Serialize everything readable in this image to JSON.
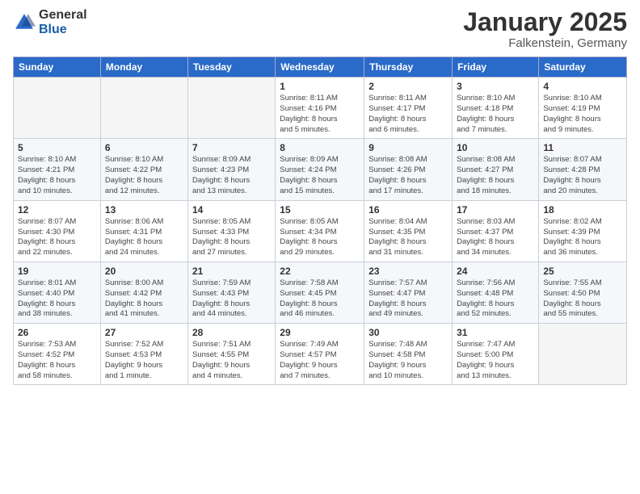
{
  "header": {
    "logo_general": "General",
    "logo_blue": "Blue",
    "title": "January 2025",
    "subtitle": "Falkenstein, Germany"
  },
  "days_of_week": [
    "Sunday",
    "Monday",
    "Tuesday",
    "Wednesday",
    "Thursday",
    "Friday",
    "Saturday"
  ],
  "weeks": [
    [
      {
        "num": "",
        "info": "",
        "empty": true
      },
      {
        "num": "",
        "info": "",
        "empty": true
      },
      {
        "num": "",
        "info": "",
        "empty": true
      },
      {
        "num": "1",
        "info": "Sunrise: 8:11 AM\nSunset: 4:16 PM\nDaylight: 8 hours\nand 5 minutes."
      },
      {
        "num": "2",
        "info": "Sunrise: 8:11 AM\nSunset: 4:17 PM\nDaylight: 8 hours\nand 6 minutes."
      },
      {
        "num": "3",
        "info": "Sunrise: 8:10 AM\nSunset: 4:18 PM\nDaylight: 8 hours\nand 7 minutes."
      },
      {
        "num": "4",
        "info": "Sunrise: 8:10 AM\nSunset: 4:19 PM\nDaylight: 8 hours\nand 9 minutes."
      }
    ],
    [
      {
        "num": "5",
        "info": "Sunrise: 8:10 AM\nSunset: 4:21 PM\nDaylight: 8 hours\nand 10 minutes."
      },
      {
        "num": "6",
        "info": "Sunrise: 8:10 AM\nSunset: 4:22 PM\nDaylight: 8 hours\nand 12 minutes."
      },
      {
        "num": "7",
        "info": "Sunrise: 8:09 AM\nSunset: 4:23 PM\nDaylight: 8 hours\nand 13 minutes."
      },
      {
        "num": "8",
        "info": "Sunrise: 8:09 AM\nSunset: 4:24 PM\nDaylight: 8 hours\nand 15 minutes."
      },
      {
        "num": "9",
        "info": "Sunrise: 8:08 AM\nSunset: 4:26 PM\nDaylight: 8 hours\nand 17 minutes."
      },
      {
        "num": "10",
        "info": "Sunrise: 8:08 AM\nSunset: 4:27 PM\nDaylight: 8 hours\nand 18 minutes."
      },
      {
        "num": "11",
        "info": "Sunrise: 8:07 AM\nSunset: 4:28 PM\nDaylight: 8 hours\nand 20 minutes."
      }
    ],
    [
      {
        "num": "12",
        "info": "Sunrise: 8:07 AM\nSunset: 4:30 PM\nDaylight: 8 hours\nand 22 minutes."
      },
      {
        "num": "13",
        "info": "Sunrise: 8:06 AM\nSunset: 4:31 PM\nDaylight: 8 hours\nand 24 minutes."
      },
      {
        "num": "14",
        "info": "Sunrise: 8:05 AM\nSunset: 4:33 PM\nDaylight: 8 hours\nand 27 minutes."
      },
      {
        "num": "15",
        "info": "Sunrise: 8:05 AM\nSunset: 4:34 PM\nDaylight: 8 hours\nand 29 minutes."
      },
      {
        "num": "16",
        "info": "Sunrise: 8:04 AM\nSunset: 4:35 PM\nDaylight: 8 hours\nand 31 minutes."
      },
      {
        "num": "17",
        "info": "Sunrise: 8:03 AM\nSunset: 4:37 PM\nDaylight: 8 hours\nand 34 minutes."
      },
      {
        "num": "18",
        "info": "Sunrise: 8:02 AM\nSunset: 4:39 PM\nDaylight: 8 hours\nand 36 minutes."
      }
    ],
    [
      {
        "num": "19",
        "info": "Sunrise: 8:01 AM\nSunset: 4:40 PM\nDaylight: 8 hours\nand 38 minutes."
      },
      {
        "num": "20",
        "info": "Sunrise: 8:00 AM\nSunset: 4:42 PM\nDaylight: 8 hours\nand 41 minutes."
      },
      {
        "num": "21",
        "info": "Sunrise: 7:59 AM\nSunset: 4:43 PM\nDaylight: 8 hours\nand 44 minutes."
      },
      {
        "num": "22",
        "info": "Sunrise: 7:58 AM\nSunset: 4:45 PM\nDaylight: 8 hours\nand 46 minutes."
      },
      {
        "num": "23",
        "info": "Sunrise: 7:57 AM\nSunset: 4:47 PM\nDaylight: 8 hours\nand 49 minutes."
      },
      {
        "num": "24",
        "info": "Sunrise: 7:56 AM\nSunset: 4:48 PM\nDaylight: 8 hours\nand 52 minutes."
      },
      {
        "num": "25",
        "info": "Sunrise: 7:55 AM\nSunset: 4:50 PM\nDaylight: 8 hours\nand 55 minutes."
      }
    ],
    [
      {
        "num": "26",
        "info": "Sunrise: 7:53 AM\nSunset: 4:52 PM\nDaylight: 8 hours\nand 58 minutes."
      },
      {
        "num": "27",
        "info": "Sunrise: 7:52 AM\nSunset: 4:53 PM\nDaylight: 9 hours\nand 1 minute."
      },
      {
        "num": "28",
        "info": "Sunrise: 7:51 AM\nSunset: 4:55 PM\nDaylight: 9 hours\nand 4 minutes."
      },
      {
        "num": "29",
        "info": "Sunrise: 7:49 AM\nSunset: 4:57 PM\nDaylight: 9 hours\nand 7 minutes."
      },
      {
        "num": "30",
        "info": "Sunrise: 7:48 AM\nSunset: 4:58 PM\nDaylight: 9 hours\nand 10 minutes."
      },
      {
        "num": "31",
        "info": "Sunrise: 7:47 AM\nSunset: 5:00 PM\nDaylight: 9 hours\nand 13 minutes."
      },
      {
        "num": "",
        "info": "",
        "empty": true
      }
    ]
  ]
}
